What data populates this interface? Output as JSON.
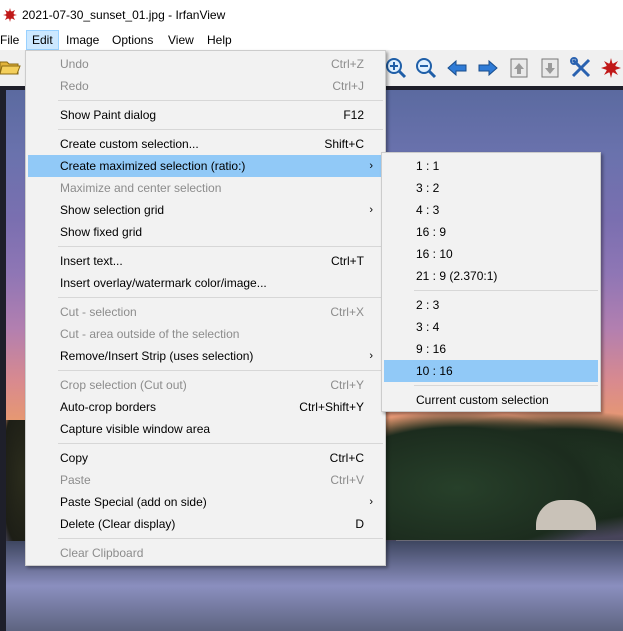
{
  "window": {
    "title": "2021-07-30_sunset_01.jpg - IrfanView"
  },
  "menubar": {
    "items": [
      "File",
      "Edit",
      "Image",
      "Options",
      "View",
      "Help"
    ],
    "active": "Edit"
  },
  "toolbar": {
    "icons": [
      "open-folder-icon",
      "zoom-in-icon",
      "zoom-out-icon",
      "previous-icon",
      "next-icon",
      "page-up-icon",
      "page-down-icon",
      "tools-icon",
      "irfanview-logo-icon"
    ]
  },
  "edit_menu": {
    "items": [
      {
        "label": "Undo",
        "shortcut": "Ctrl+Z",
        "disabled": true
      },
      {
        "label": "Redo",
        "shortcut": "Ctrl+J",
        "disabled": true
      },
      {
        "label": "Show Paint dialog",
        "shortcut": "F12"
      },
      {
        "label": "Create custom selection...",
        "shortcut": "Shift+C"
      },
      {
        "label": "Create maximized selection (ratio:)",
        "submenu": true,
        "highlighted": true
      },
      {
        "label": "Maximize and center selection",
        "disabled": true
      },
      {
        "label": "Show selection grid",
        "submenu": true
      },
      {
        "label": "Show fixed grid"
      },
      {
        "label": "Insert text...",
        "shortcut": "Ctrl+T"
      },
      {
        "label": "Insert overlay/watermark color/image..."
      },
      {
        "label": "Cut - selection",
        "shortcut": "Ctrl+X",
        "disabled": true
      },
      {
        "label": "Cut - area outside of the selection",
        "disabled": true
      },
      {
        "label": "Remove/Insert Strip (uses selection)",
        "submenu": true
      },
      {
        "label": "Crop selection (Cut out)",
        "shortcut": "Ctrl+Y",
        "disabled": true
      },
      {
        "label": "Auto-crop borders",
        "shortcut": "Ctrl+Shift+Y"
      },
      {
        "label": "Capture visible window area"
      },
      {
        "label": "Copy",
        "shortcut": "Ctrl+C"
      },
      {
        "label": "Paste",
        "shortcut": "Ctrl+V",
        "disabled": true
      },
      {
        "label": "Paste Special (add on side)",
        "submenu": true
      },
      {
        "label": "Delete (Clear display)",
        "shortcut": "D"
      },
      {
        "label": "Clear Clipboard",
        "disabled": true
      }
    ]
  },
  "ratio_submenu": {
    "items": [
      {
        "label": "1 : 1"
      },
      {
        "label": "3 : 2"
      },
      {
        "label": "4 : 3"
      },
      {
        "label": "16 : 9"
      },
      {
        "label": "16 : 10"
      },
      {
        "label": "21 : 9 (2.370:1)"
      },
      {
        "label": "2 : 3"
      },
      {
        "label": "3 : 4"
      },
      {
        "label": "9 : 16"
      },
      {
        "label": "10 : 16",
        "highlighted": true
      },
      {
        "label": "Current custom selection"
      }
    ]
  },
  "colors": {
    "menu_highlight": "#91c9f7",
    "menubar_active": "#cce8ff",
    "disabled_text": "#8c8c8c"
  }
}
